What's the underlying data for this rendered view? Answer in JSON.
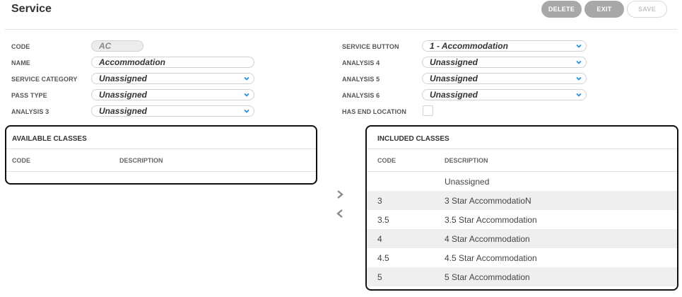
{
  "header": {
    "title": "Service",
    "delete_label": "DELETE",
    "exit_label": "EXIT",
    "save_label": "SAVE"
  },
  "form_left": [
    {
      "label": "CODE",
      "value": "AC",
      "kind": "readonly"
    },
    {
      "label": "NAME",
      "value": "Accommodation",
      "kind": "text"
    },
    {
      "label": "SERVICE CATEGORY",
      "value": "Unassigned",
      "kind": "select"
    },
    {
      "label": "PASS TYPE",
      "value": "Unassigned",
      "kind": "select"
    },
    {
      "label": "ANALYSIS 3",
      "value": "Unassigned",
      "kind": "select"
    }
  ],
  "form_right": [
    {
      "label": "SERVICE BUTTON",
      "value": "1 - Accommodation",
      "kind": "select"
    },
    {
      "label": "ANALYSIS 4",
      "value": "Unassigned",
      "kind": "select"
    },
    {
      "label": "ANALYSIS 5",
      "value": "Unassigned",
      "kind": "select"
    },
    {
      "label": "ANALYSIS 6",
      "value": "Unassigned",
      "kind": "select"
    },
    {
      "label": "HAS END LOCATION",
      "value": false,
      "kind": "checkbox"
    }
  ],
  "available": {
    "title": "AVAILABLE CLASSES",
    "col_code": "CODE",
    "col_description": "DESCRIPTION",
    "rows": []
  },
  "included": {
    "title": "INCLUDED CLASSES",
    "col_code": "CODE",
    "col_description": "DESCRIPTION",
    "rows": [
      {
        "code": "",
        "description": "Unassigned"
      },
      {
        "code": "3",
        "description": "3 Star AccommodatioN"
      },
      {
        "code": "3.5",
        "description": "3.5 Star Accommodation"
      },
      {
        "code": "4",
        "description": "4 Star Accommodation"
      },
      {
        "code": "4.5",
        "description": "4.5 Star Accommodation"
      },
      {
        "code": "5",
        "description": "5 Star Accommodation"
      }
    ]
  },
  "icons": {
    "move_right": "chevron-right-icon",
    "move_left": "chevron-left-icon",
    "dropdown": "chevron-down-icon"
  },
  "colors": {
    "chevron": "#2a8fd8",
    "button_dark": "#a8a8a8",
    "row_alt": "#efefef"
  }
}
